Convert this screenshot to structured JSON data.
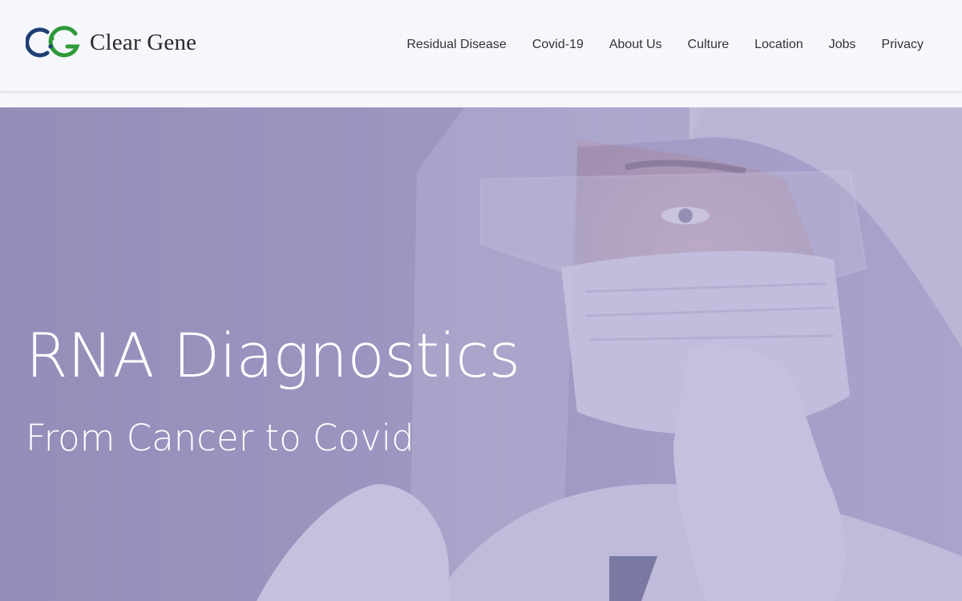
{
  "brand": {
    "name": "Clear Gene",
    "mark_colors": {
      "primary": "#1f3f73",
      "accent": "#2e9a3a"
    }
  },
  "nav": {
    "items": [
      {
        "label": "Residual Disease"
      },
      {
        "label": "Covid-19"
      },
      {
        "label": "About Us"
      },
      {
        "label": "Culture"
      },
      {
        "label": "Location"
      },
      {
        "label": "Jobs"
      },
      {
        "label": "Privacy"
      }
    ]
  },
  "hero": {
    "title": "RNA Diagnostics",
    "subtitle": "From Cancer to Covid",
    "image_icon": "lab-worker-with-face-shield-image",
    "overlay_color": "#968cbe"
  }
}
